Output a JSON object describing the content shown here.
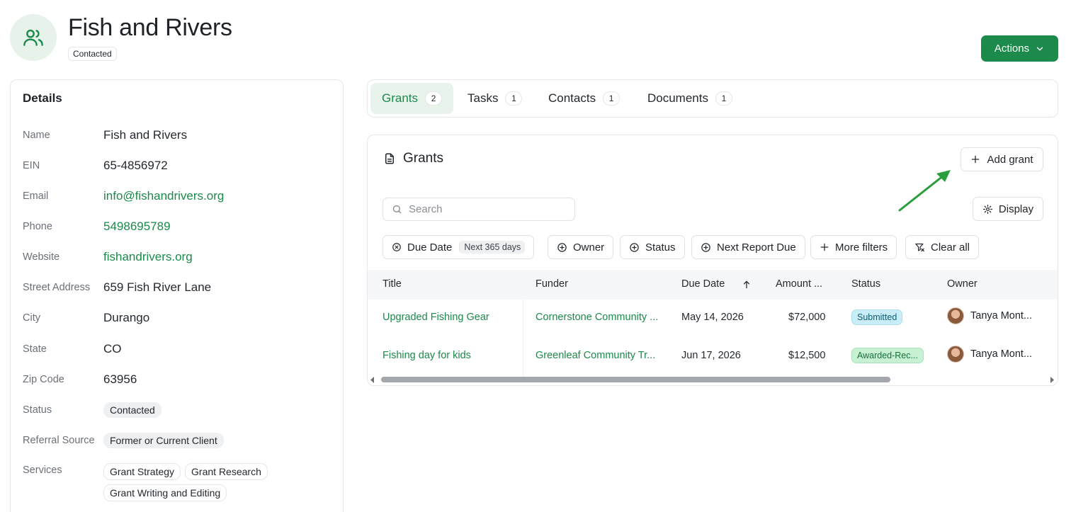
{
  "header": {
    "title": "Fish and Rivers",
    "badge": "Contacted",
    "actions_label": "Actions"
  },
  "details": {
    "title": "Details",
    "fields": [
      {
        "label": "Name",
        "value": "Fish and Rivers"
      },
      {
        "label": "EIN",
        "value": "65-4856972"
      },
      {
        "label": "Email",
        "value": "info@fishandrivers.org"
      },
      {
        "label": "Phone",
        "value": "5498695789"
      },
      {
        "label": "Website",
        "value": "fishandrivers.org"
      },
      {
        "label": "Street Address",
        "value": "659 Fish River Lane"
      },
      {
        "label": "City",
        "value": "Durango"
      },
      {
        "label": "State",
        "value": "CO"
      },
      {
        "label": "Zip Code",
        "value": "63956"
      },
      {
        "label": "Status",
        "value": "Contacted"
      },
      {
        "label": "Referral Source",
        "value": "Former or Current Client"
      },
      {
        "label": "Services",
        "values": [
          "Grant Strategy",
          "Grant Research",
          "Grant Writing and Editing"
        ]
      }
    ]
  },
  "tabs": [
    {
      "label": "Grants",
      "count": "2"
    },
    {
      "label": "Tasks",
      "count": "1"
    },
    {
      "label": "Contacts",
      "count": "1"
    },
    {
      "label": "Documents",
      "count": "1"
    }
  ],
  "grants": {
    "title": "Grants",
    "add_label": "Add grant",
    "search_placeholder": "Search",
    "display_label": "Display",
    "filters": {
      "due_date": "Due Date",
      "due_date_value": "Next 365 days",
      "owner": "Owner",
      "status": "Status",
      "next_report_due": "Next Report Due",
      "more_filters": "More filters",
      "clear_all": "Clear all"
    },
    "columns": [
      "Title",
      "Funder",
      "Due Date",
      "Amount ...",
      "Status",
      "Owner"
    ],
    "rows": [
      {
        "title": "Upgraded Fishing Gear",
        "funder": "Cornerstone Community ...",
        "due_date": "May 14, 2026",
        "amount": "$72,000",
        "status": "Submitted",
        "owner": "Tanya Mont..."
      },
      {
        "title": "Fishing day for kids",
        "funder": "Greenleaf Community Tr...",
        "due_date": "Jun 17, 2026",
        "amount": "$12,500",
        "status": "Awarded-Rec...",
        "owner": "Tanya Mont..."
      }
    ]
  },
  "colors": {
    "brand_green": "#1b8a4a",
    "status_submitted_bg": "#c9eef7",
    "status_awarded_bg": "#c8f1d4"
  }
}
